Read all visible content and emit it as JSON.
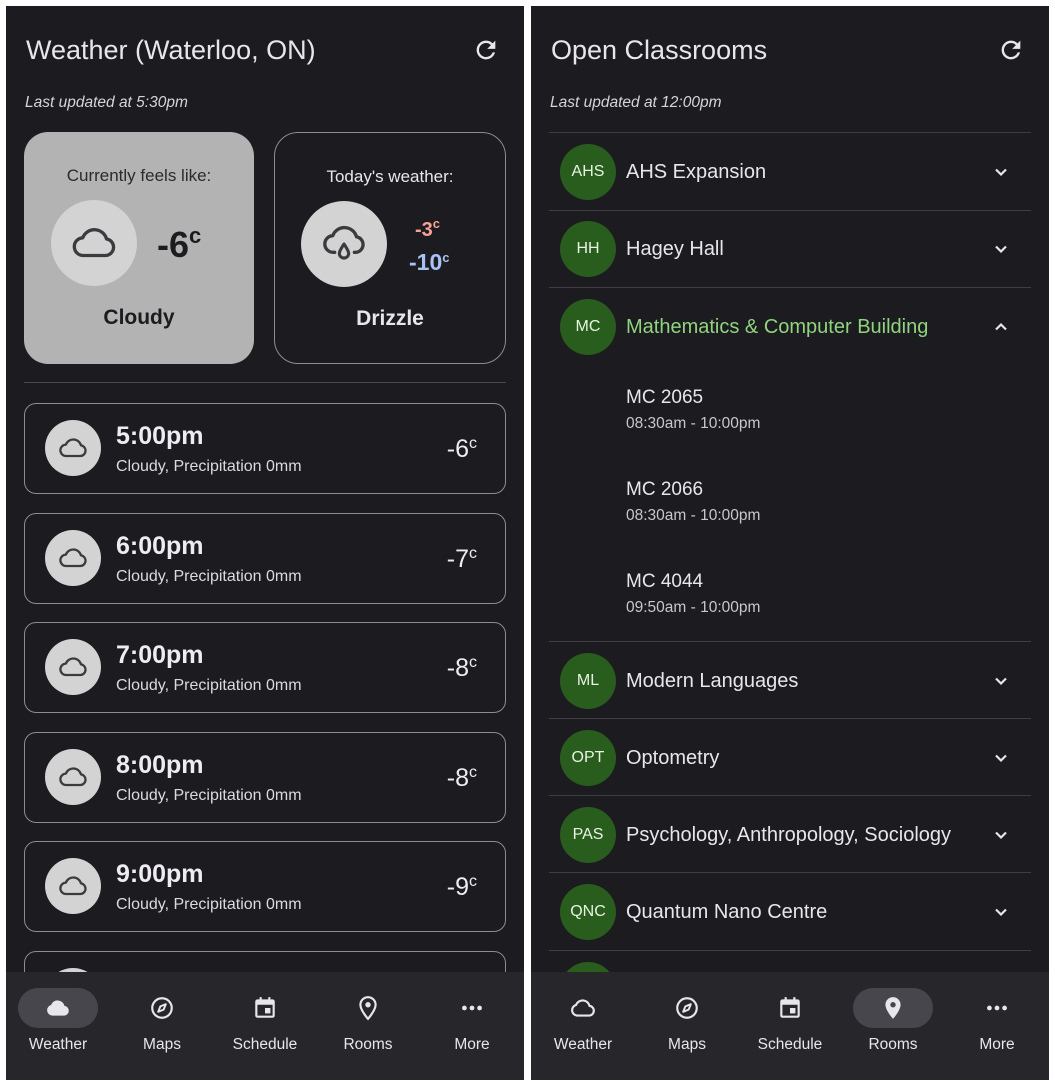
{
  "weather_screen": {
    "title": "Weather (Waterloo, ON)",
    "last_updated": "Last updated at 5:30pm",
    "current": {
      "label": "Currently feels like:",
      "temp": "-6",
      "unit": "c",
      "condition": "Cloudy",
      "icon": "cloud-icon"
    },
    "today": {
      "label": "Today's weather:",
      "high": "-3",
      "low": "-10",
      "unit": "c",
      "condition": "Drizzle",
      "icon": "drizzle-icon"
    },
    "hourly": [
      {
        "time": "5:00pm",
        "desc": "Cloudy, Precipitation 0mm",
        "temp": "-6",
        "unit": "c"
      },
      {
        "time": "6:00pm",
        "desc": "Cloudy, Precipitation 0mm",
        "temp": "-7",
        "unit": "c"
      },
      {
        "time": "7:00pm",
        "desc": "Cloudy, Precipitation 0mm",
        "temp": "-8",
        "unit": "c"
      },
      {
        "time": "8:00pm",
        "desc": "Cloudy, Precipitation 0mm",
        "temp": "-8",
        "unit": "c"
      },
      {
        "time": "9:00pm",
        "desc": "Cloudy, Precipitation 0mm",
        "temp": "-9",
        "unit": "c"
      }
    ]
  },
  "rooms_screen": {
    "title": "Open Classrooms",
    "last_updated": "Last updated at 12:00pm",
    "buildings": [
      {
        "code": "AHS",
        "name": "AHS Expansion"
      },
      {
        "code": "HH",
        "name": "Hagey Hall"
      },
      {
        "code": "MC",
        "name": "Mathematics & Computer Building",
        "expanded": true,
        "rooms": [
          {
            "name": "MC 2065",
            "hours": "08:30am - 10:00pm"
          },
          {
            "name": "MC 2066",
            "hours": "08:30am - 10:00pm"
          },
          {
            "name": "MC 4044",
            "hours": "09:50am - 10:00pm"
          }
        ]
      },
      {
        "code": "ML",
        "name": "Modern Languages"
      },
      {
        "code": "OPT",
        "name": "Optometry"
      },
      {
        "code": "PAS",
        "name": "Psychology, Anthropology, Sociology"
      },
      {
        "code": "QNC",
        "name": "Quantum Nano Centre"
      }
    ]
  },
  "nav": {
    "items": [
      {
        "label": "Weather",
        "icon": "cloud-icon"
      },
      {
        "label": "Maps",
        "icon": "compass-icon"
      },
      {
        "label": "Schedule",
        "icon": "calendar-icon"
      },
      {
        "label": "Rooms",
        "icon": "location-pin-icon"
      },
      {
        "label": "More",
        "icon": "more-icon"
      }
    ],
    "active_left": "Weather",
    "active_right": "Rooms"
  },
  "colors": {
    "background": "#1c1b20",
    "current_card": "#b3b3b3",
    "high_temp": "#f4a394",
    "low_temp": "#a8c2f4",
    "building_avatar": "#295d1d",
    "expanded_accent": "#8fd47e",
    "nav_bar": "#27262b"
  }
}
